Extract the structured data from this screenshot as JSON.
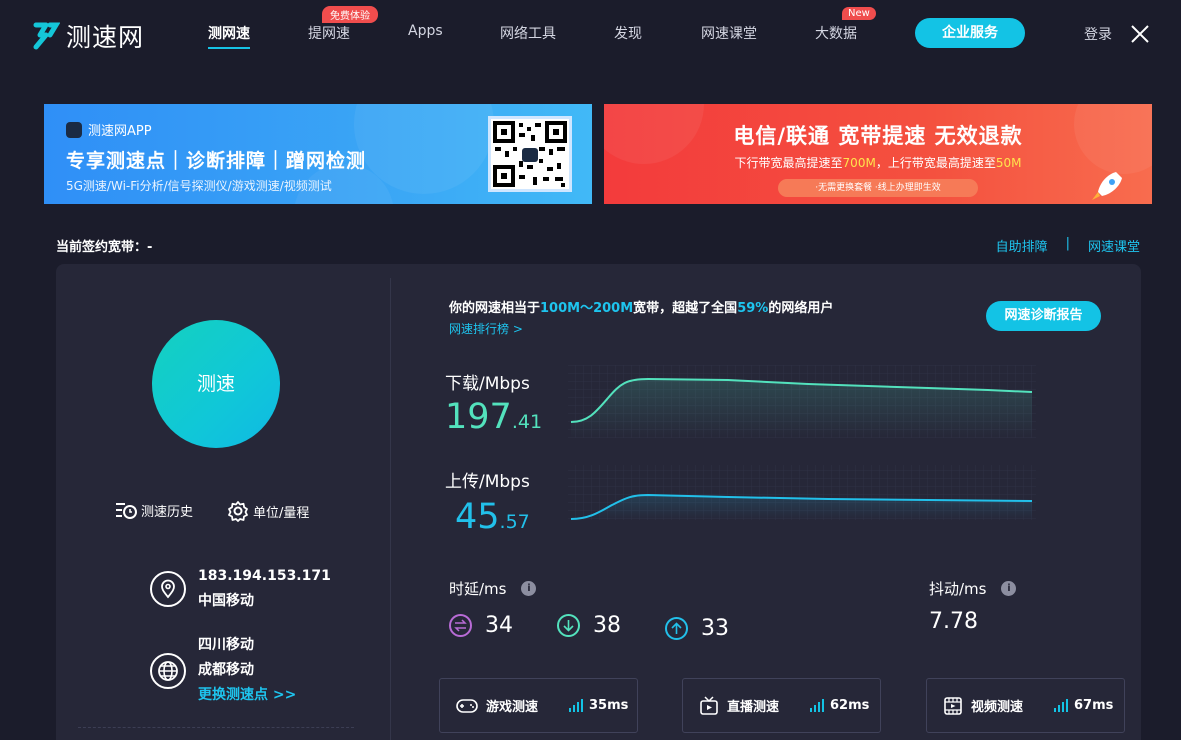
{
  "header": {
    "logo_text": "测速网",
    "nav": [
      {
        "label": "测网速"
      },
      {
        "label": "提网速",
        "badge": "免费体验"
      },
      {
        "label": "Apps"
      },
      {
        "label": "网络工具"
      },
      {
        "label": "发现"
      },
      {
        "label": "网速课堂"
      },
      {
        "label": "大数据",
        "badge": "New"
      }
    ],
    "enterprise_button": "企业服务",
    "login": "登录"
  },
  "banner_left": {
    "app_label": "测速网APP",
    "headline": "专享测速点｜诊断排障｜蹭网检测",
    "sub": "5G测速/Wi-Fi分析/信号探测仪/游戏测速/视频测试"
  },
  "banner_right": {
    "headline": "电信/联通 宽带提速 无效退款",
    "sub_prefix": "下行带宽最高提速至",
    "sub_down": "700M",
    "sub_mid": "，上行带宽最高提速至",
    "sub_up": "50M",
    "pill": "·无需更换套餐  ·线上办理即生效"
  },
  "contract": "当前签约宽带：-",
  "top_links": {
    "self_help": "自助排障",
    "sep": "|",
    "class": "网速课堂"
  },
  "left": {
    "start_button": "测速",
    "history": "测速历史",
    "unit": "单位/量程",
    "ip": "183.194.153.171",
    "isp": "中国移动",
    "node_region": "四川移动",
    "node_name": "成都移动",
    "change_node": "更换测速点 >>"
  },
  "right": {
    "summary_pre": "你的网速相当于",
    "summary_range": "100M～200M",
    "summary_mid": "宽带，超越了全国",
    "summary_pct": "59%",
    "summary_post": "的网络用户",
    "rank_link": "网速排行榜 >",
    "diag_button": "网速诊断报告",
    "download_label": "下载/Mbps",
    "download_int": "197",
    "download_dec": ".41",
    "upload_label": "上传/Mbps",
    "upload_int": "45",
    "upload_dec": ".57",
    "latency_label": "时延/ms",
    "latency_q": "i",
    "jitter_label": "抖动/ms",
    "jitter_q": "i",
    "latency": "34",
    "latency_down": "38",
    "latency_up": "33",
    "jitter": "7.78"
  },
  "cards": [
    {
      "label": "游戏测速",
      "value": "35ms"
    },
    {
      "label": "直播测速",
      "value": "62ms"
    },
    {
      "label": "视频测速",
      "value": "67ms"
    }
  ],
  "colors": {
    "accent": "#13c3e5",
    "download": "#53e2bd",
    "upload": "#22c0ea",
    "bg": "#1b1c2b",
    "panel": "#262738"
  }
}
